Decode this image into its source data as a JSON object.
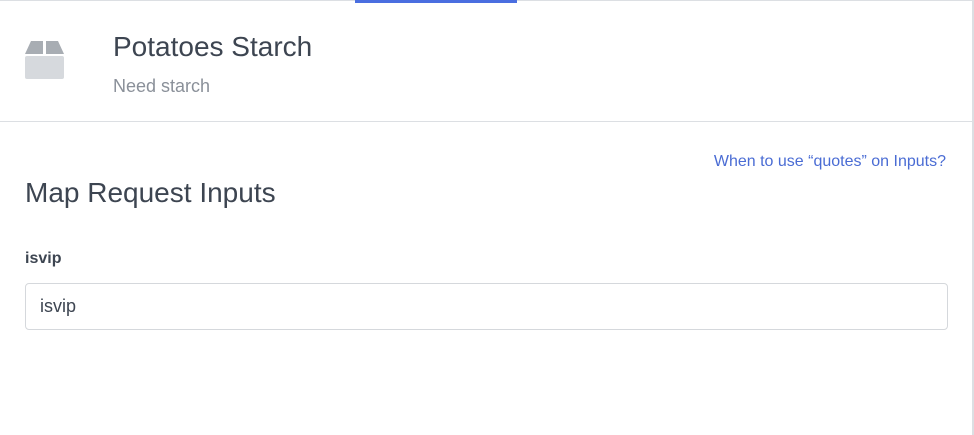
{
  "header": {
    "icon": "box-icon",
    "title": "Potatoes Starch",
    "subtitle": "Need starch"
  },
  "main": {
    "help_link": "When to use “quotes” on Inputs?",
    "section_title": "Map Request Inputs",
    "fields": [
      {
        "label": "isvip",
        "value": "isvip",
        "placeholder": ""
      }
    ]
  },
  "colors": {
    "accent": "#4a6ee0",
    "link": "#4a6cd4",
    "text": "#3d4551",
    "muted": "#8a9099",
    "border": "#dcdfe3"
  }
}
